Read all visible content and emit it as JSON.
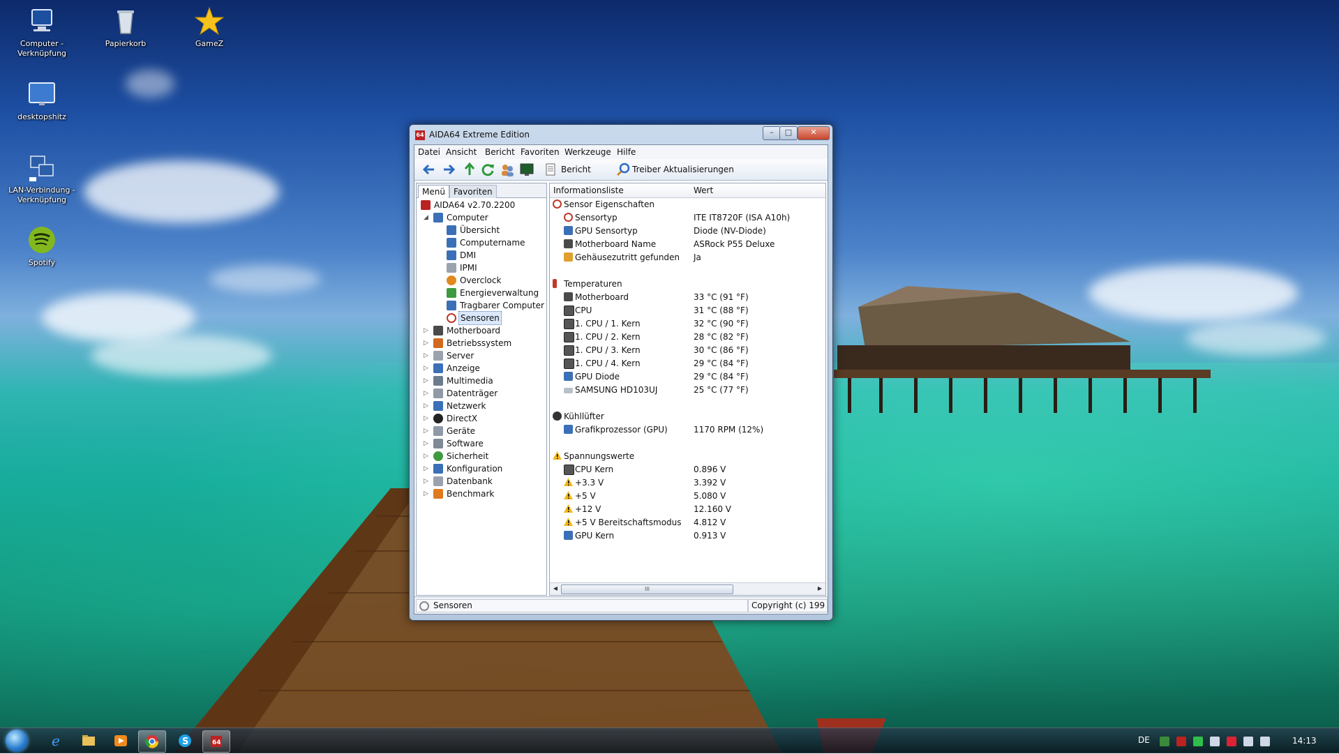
{
  "desktop": {
    "icons": [
      {
        "label": "Computer - Verknüpfung",
        "icon": "computer-icon"
      },
      {
        "label": "Papierkorb",
        "icon": "recycle-bin-icon"
      },
      {
        "label": "GameZ",
        "icon": "star-icon"
      },
      {
        "label": "desktopshitz",
        "icon": "monitor-icon"
      },
      {
        "label": "LAN-Verbindung - Verknüpfung",
        "icon": "network-icon"
      },
      {
        "label": "Spotify",
        "icon": "spotify-icon"
      }
    ]
  },
  "window": {
    "title": "AIDA64 Extreme Edition",
    "title_icon_text": "64",
    "menu": [
      "Datei",
      "Ansicht",
      "Bericht",
      "Favoriten",
      "Werkzeuge",
      "Hilfe"
    ],
    "toolbar": {
      "report_label": "Bericht",
      "driver_update_label": "Treiber Aktualisierungen"
    },
    "tabs": [
      "Menü",
      "Favoriten"
    ],
    "tree": {
      "root": "AIDA64 v2.70.2200",
      "computer": "Computer",
      "computer_children": [
        "Übersicht",
        "Computername",
        "DMI",
        "IPMI",
        "Overclock",
        "Energieverwaltung",
        "Tragbarer Computer",
        "Sensoren"
      ],
      "top_items": [
        "Motherboard",
        "Betriebssystem",
        "Server",
        "Anzeige",
        "Multimedia",
        "Datenträger",
        "Netzwerk",
        "DirectX",
        "Geräte",
        "Software",
        "Sicherheit",
        "Konfiguration",
        "Datenbank",
        "Benchmark"
      ]
    },
    "columns": {
      "info": "Informationsliste",
      "value": "Wert"
    },
    "sections": {
      "sensor_props": {
        "title": "Sensor Eigenschaften",
        "rows": [
          {
            "k": "Sensortyp",
            "v": "ITE IT8720F (ISA A10h)"
          },
          {
            "k": "GPU Sensortyp",
            "v": "Diode (NV-Diode)"
          },
          {
            "k": "Motherboard Name",
            "v": "ASRock P55 Deluxe"
          },
          {
            "k": "Gehäusezutritt gefunden",
            "v": "Ja"
          }
        ]
      },
      "temps": {
        "title": "Temperaturen",
        "rows": [
          {
            "k": "Motherboard",
            "v": "33 °C  (91 °F)"
          },
          {
            "k": "CPU",
            "v": "31 °C  (88 °F)"
          },
          {
            "k": "1. CPU / 1. Kern",
            "v": "32 °C  (90 °F)"
          },
          {
            "k": "1. CPU / 2. Kern",
            "v": "28 °C  (82 °F)"
          },
          {
            "k": "1. CPU / 3. Kern",
            "v": "30 °C  (86 °F)"
          },
          {
            "k": "1. CPU / 4. Kern",
            "v": "29 °C  (84 °F)"
          },
          {
            "k": "GPU Diode",
            "v": "29 °C  (84 °F)"
          },
          {
            "k": "SAMSUNG HD103UJ",
            "v": "25 °C  (77 °F)"
          }
        ]
      },
      "fans": {
        "title": "Kühllüfter",
        "rows": [
          {
            "k": "Grafikprozessor (GPU)",
            "v": "1170 RPM  (12%)"
          }
        ]
      },
      "volts": {
        "title": "Spannungswerte",
        "rows": [
          {
            "k": "CPU Kern",
            "v": "0.896 V"
          },
          {
            "k": "+3.3 V",
            "v": "3.392 V"
          },
          {
            "k": "+5 V",
            "v": "5.080 V"
          },
          {
            "k": "+12 V",
            "v": "12.160 V"
          },
          {
            "k": "+5 V Bereitschaftsmodus",
            "v": "4.812 V"
          },
          {
            "k": "GPU Kern",
            "v": "0.913 V"
          }
        ]
      }
    },
    "scroll_thumb": "III",
    "status": {
      "left": "Sensoren",
      "right": "Copyright (c) 199"
    }
  },
  "taskbar": {
    "language": "DE",
    "clock": "14:13",
    "apps": [
      "internet-explorer-icon",
      "explorer-folder-icon",
      "media-player-icon",
      "chrome-icon",
      "skype-icon",
      "aida64-icon"
    ]
  }
}
